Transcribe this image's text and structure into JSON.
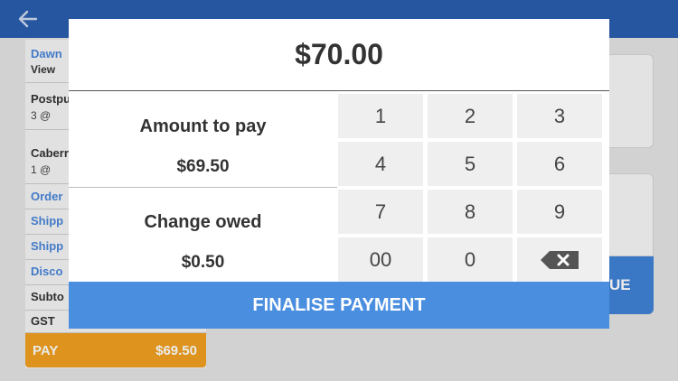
{
  "background": {
    "cart_rows": [
      {
        "text": "Dawn",
        "style": "link"
      },
      {
        "text": "View",
        "style": "button"
      },
      {
        "text": "Postpu",
        "sub": "3 @",
        "style": "dark"
      },
      {
        "text": "Caberr",
        "sub": "1 @",
        "style": "dark"
      },
      {
        "text": "Order",
        "style": "link"
      },
      {
        "text": "Shipp",
        "style": "link"
      },
      {
        "text": "Shipp",
        "style": "link"
      },
      {
        "text": "Disco",
        "style": "link"
      },
      {
        "text": "Subto",
        "style": "dark"
      },
      {
        "text": "GST",
        "style": "dark"
      }
    ],
    "pay_label": "PAY",
    "pay_amount": "$69.50",
    "continue_fragment": "UE"
  },
  "modal": {
    "total": "$70.00",
    "amount_to_pay_label": "Amount to pay",
    "amount_to_pay": "$69.50",
    "change_owed_label": "Change owed",
    "change_owed": "$0.50",
    "keypad": [
      "1",
      "2",
      "3",
      "4",
      "5",
      "6",
      "7",
      "8",
      "9",
      "00",
      "0",
      "backspace"
    ],
    "finalise_label": "FINALISE PAYMENT"
  },
  "colors": {
    "app_bar": "#2b5eae",
    "accent_blue": "#4a8ee0",
    "pay_orange": "#f0a020"
  },
  "icons": [
    "back-arrow-icon",
    "backspace-icon"
  ]
}
